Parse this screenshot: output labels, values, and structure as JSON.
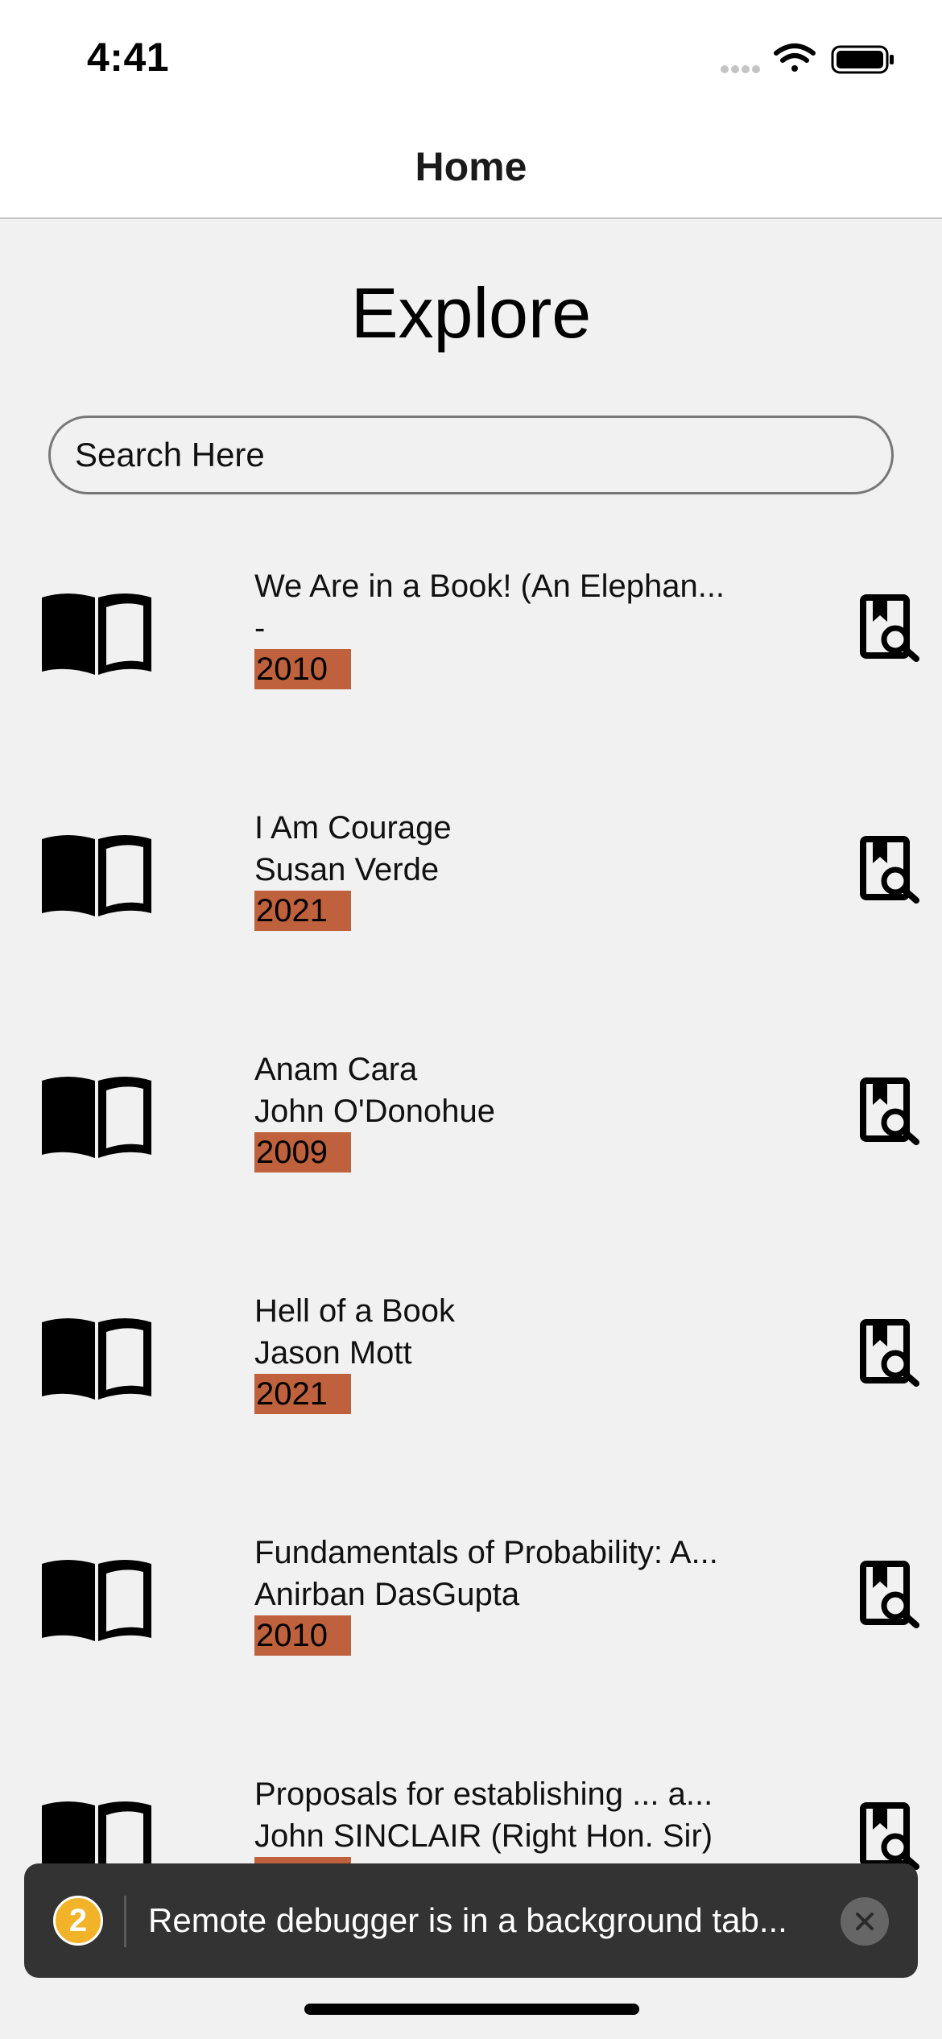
{
  "status_bar": {
    "time": "4:41",
    "icons": [
      "signal-dots-icon",
      "wifi-icon",
      "battery-icon"
    ]
  },
  "nav": {
    "title": "Home"
  },
  "page": {
    "title": "Explore"
  },
  "search": {
    "placeholder": "Search Here",
    "value": ""
  },
  "books": [
    {
      "title": "We Are in a Book! (An Elephan...",
      "author": "-",
      "year": "2010"
    },
    {
      "title": "I Am Courage",
      "author": "Susan Verde",
      "year": "2021"
    },
    {
      "title": "Anam Cara",
      "author": "John O'Donohue",
      "year": "2009"
    },
    {
      "title": "Hell of a Book",
      "author": "Jason Mott",
      "year": "2021"
    },
    {
      "title": "Fundamentals of Probability: A...",
      "author": "Anirban DasGupta",
      "year": "2010"
    },
    {
      "title": "Proposals for establishing ... a...",
      "author": "John SINCLAIR (Right Hon. Sir)",
      "year": ""
    }
  ],
  "toast": {
    "badge_count": "2",
    "message": "Remote debugger is in a background tab..."
  },
  "colors": {
    "background": "#f1f1f1",
    "year_badge": "#c0613d",
    "toast_bg": "#333333",
    "toast_badge": "#f2b328"
  }
}
